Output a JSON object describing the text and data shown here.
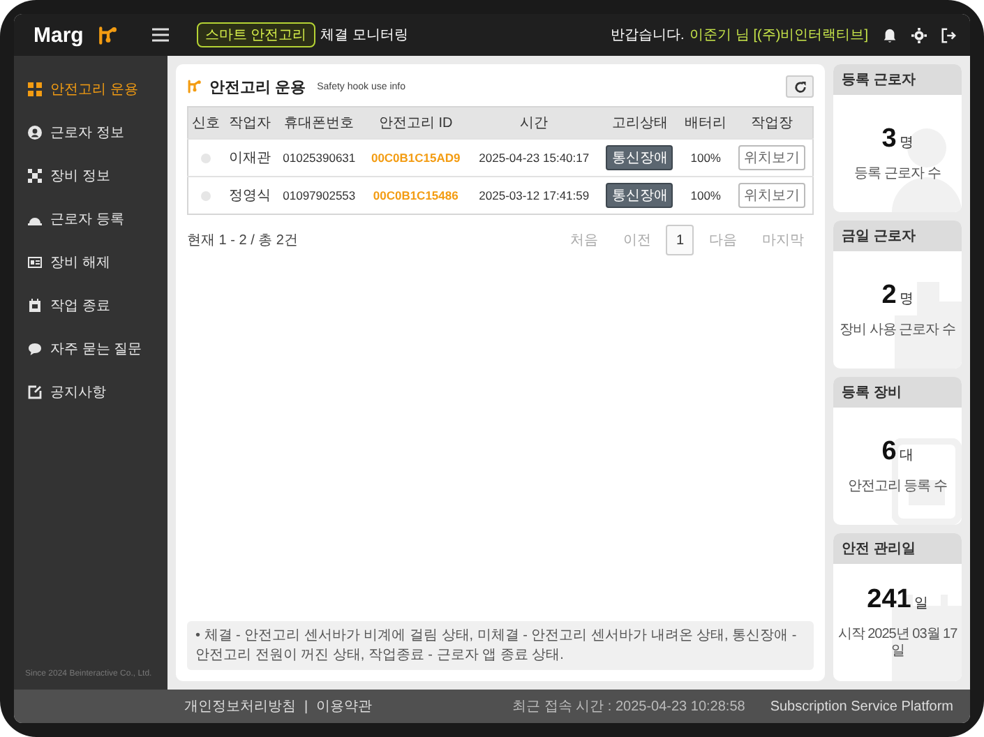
{
  "header": {
    "logo": "Marg",
    "badge": "스마트 안전고리",
    "title": "체결 모니터링",
    "greeting": "반갑습니다.",
    "user": "이준기 님 [(주)비인터랙티브]"
  },
  "sidebar": {
    "items": [
      {
        "label": "안전고리 운용",
        "selected": true
      },
      {
        "label": "근로자 정보",
        "selected": false
      },
      {
        "label": "장비 정보",
        "selected": false
      },
      {
        "label": "근로자 등록",
        "selected": false
      },
      {
        "label": "장비 해제",
        "selected": false
      },
      {
        "label": "작업 종료",
        "selected": false
      },
      {
        "label": "자주 묻는 질문",
        "selected": false
      },
      {
        "label": "공지사항",
        "selected": false
      }
    ],
    "copyright": "Since 2024 Beinteractive Co., Ltd."
  },
  "panel": {
    "title": "안전고리 운용",
    "subtitle": "Safety hook use info",
    "table": {
      "columns": [
        "신호",
        "작업자",
        "휴대폰번호",
        "안전고리 ID",
        "시간",
        "고리상태",
        "배터리",
        "작업장"
      ],
      "rows": [
        {
          "color": "#e6e6e6",
          "worker": "이재관",
          "phone": "01025390631",
          "hook_id": "00C0B1C15AD9",
          "time": "2025-04-23 15:40:17",
          "status": "통신장애",
          "battery": "100%",
          "action": "위치보기"
        },
        {
          "color": "#e6e6e6",
          "worker": "정영식",
          "phone": "01097902553",
          "hook_id": "00C0B1C15486",
          "time": "2025-03-12 17:41:59",
          "status": "통신장애",
          "battery": "100%",
          "action": "위치보기"
        }
      ]
    },
    "summary": "현재 1 - 2 / 총 2건",
    "pagination": [
      {
        "label": "처음",
        "selected": false
      },
      {
        "label": "이전",
        "selected": false
      },
      {
        "label": "1",
        "selected": true
      },
      {
        "label": "다음",
        "selected": false
      },
      {
        "label": "마지막",
        "selected": false
      }
    ],
    "note": "• 체결 - 안전고리 센서바가 비계에 걸림 상태, 미체결 - 안전고리 센서바가 내려온 상태, 통신장애 - 안전고리 전원이 꺼진 상태, 작업종료 - 근로자 앱 종료 상태."
  },
  "stats": [
    {
      "kind": "person",
      "title": "등록 근로자",
      "value": "3",
      "unit": "명",
      "caption": "등록 근로자 수"
    },
    {
      "kind": "building",
      "title": "금일 근로자",
      "value": "2",
      "unit": "명",
      "caption": "장비 사용 근로자 수"
    },
    {
      "kind": "device",
      "title": "등록 장비",
      "value": "6",
      "unit": "대",
      "caption": "안전고리 등록 수"
    },
    {
      "kind": "calendar",
      "title": "안전 관리일",
      "value": "241",
      "unit": "일",
      "caption": "시작 2025년 03월 17일"
    }
  ],
  "footer": {
    "links": [
      "개인정보처리방침",
      "이용약관"
    ],
    "separator": "|",
    "last_login": "최근 접속 시간 : 2025-04-23 10:28:58",
    "platform": "Subscription Service Platform"
  }
}
